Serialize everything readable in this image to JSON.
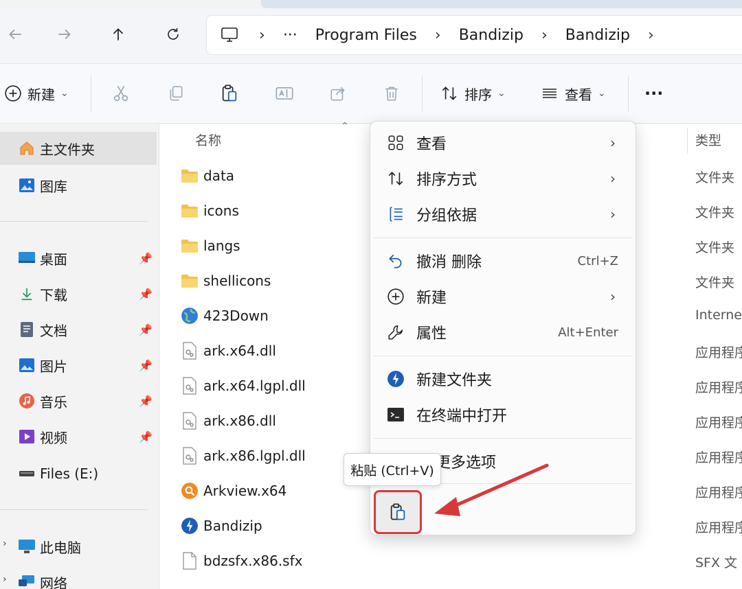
{
  "breadcrumb": {
    "overflow": "···",
    "segments": [
      "Program Files",
      "Bandizip",
      "Bandizip"
    ]
  },
  "toolbar": {
    "new_label": "新建",
    "sort_label": "排序",
    "view_label": "查看",
    "more": "···"
  },
  "sidebar": {
    "home": "主文件夹",
    "gallery": "图库",
    "desktop": "桌面",
    "downloads": "下载",
    "documents": "文档",
    "pictures": "图片",
    "music": "音乐",
    "videos": "视频",
    "drive": "Files (E:)",
    "this_pc": "此电脑",
    "network": "网络"
  },
  "columns": {
    "name": "名称",
    "type": "类型"
  },
  "files": [
    {
      "name": "data",
      "type": "文件夹",
      "icon": "folder-icon"
    },
    {
      "name": "icons",
      "type": "文件夹",
      "icon": "folder-icon"
    },
    {
      "name": "langs",
      "type": "文件夹",
      "icon": "folder-icon"
    },
    {
      "name": "shellicons",
      "type": "文件夹",
      "icon": "folder-icon"
    },
    {
      "name": "423Down",
      "type": "Interne",
      "icon": "globe-icon"
    },
    {
      "name": "ark.x64.dll",
      "type": "应用程序",
      "icon": "dll-icon"
    },
    {
      "name": "ark.x64.lgpl.dll",
      "type": "应用程序",
      "icon": "dll-icon"
    },
    {
      "name": "ark.x86.dll",
      "type": "应用程序",
      "icon": "dll-icon"
    },
    {
      "name": "ark.x86.lgpl.dll",
      "type": "应用程序",
      "icon": "dll-icon"
    },
    {
      "name": "Arkview.x64",
      "type": "应用程序",
      "icon": "arkview-icon"
    },
    {
      "name": "Bandizip",
      "type": "应用程序",
      "icon": "bandizip-icon"
    },
    {
      "name": "bdzsfx.x86.sfx",
      "type": "SFX 文",
      "icon": "file-icon"
    }
  ],
  "context_menu": {
    "view": "查看",
    "sort_by": "排序方式",
    "group_by": "分组依据",
    "undo": "撤消 删除",
    "undo_shortcut": "Ctrl+Z",
    "new": "新建",
    "properties": "属性",
    "properties_shortcut": "Alt+Enter",
    "new_folder": "新建文件夹",
    "open_terminal": "在终端中打开",
    "more_options": "示更多选项"
  },
  "tooltip": "粘贴 (Ctrl+V)",
  "colors": {
    "highlight_border": "#d9383a",
    "arrow": "#d9383a"
  }
}
